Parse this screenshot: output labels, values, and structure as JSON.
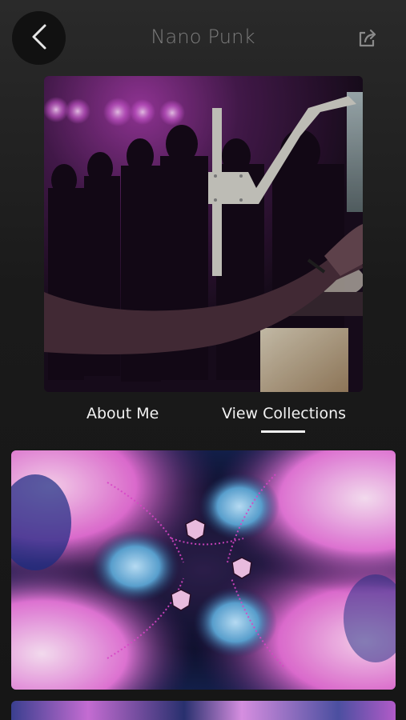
{
  "header": {
    "title": "Nano Punk",
    "back_icon": "chevron-left-icon",
    "share_icon": "share-icon"
  },
  "profile": {
    "photo_subject": "dj-performing-at-club"
  },
  "tabs": [
    {
      "label": "About Me",
      "selected": false
    },
    {
      "label": "View Collections",
      "selected": true
    }
  ],
  "collections": [
    {
      "image": "kaleidoscope-pink-blue-artwork"
    },
    {
      "image": "kaleidoscope-artwork-partial"
    }
  ],
  "colors": {
    "background": "#1c1c1c",
    "title": "#7c7c7c",
    "tab_text": "#f2f2f2",
    "accent_pink": "#e25ad8",
    "accent_blue": "#5da7d8"
  }
}
